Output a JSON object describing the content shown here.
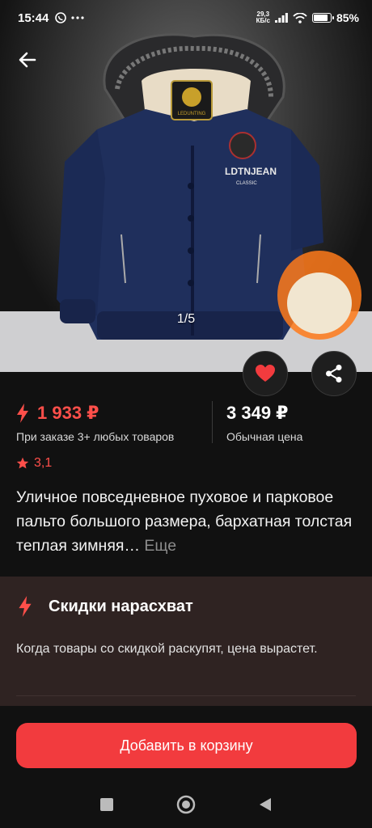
{
  "status_bar": {
    "time": "15:44",
    "net_speed_value": "29,3",
    "net_speed_unit": "КБ/с",
    "battery_percent": "85%",
    "battery_level": 0.85
  },
  "gallery": {
    "counter": "1/5",
    "jacket_brand": "LDTNJEAN",
    "jacket_brand_sub": "CLASSIC",
    "jacket_patch": "LEDUNTING"
  },
  "price": {
    "promo_price": "1 933 ₽",
    "promo_note": "При заказе 3+ любых товаров",
    "regular_price": "3 349 ₽",
    "regular_note": "Обычная цена"
  },
  "rating": {
    "value": "3,1"
  },
  "product": {
    "title": "Уличное повседневное пуховое и парковое пальто большого размера, бархатная толстая теплая зимняя…",
    "more_label": "Еще"
  },
  "deal": {
    "title": "Скидки нарасхват",
    "text": "Когда товары со скидкой раскупят, цена вырастет."
  },
  "cart": {
    "label": "Добавить в корзину"
  },
  "colors": {
    "accent_red": "#f23b3e",
    "price_red": "#ff4f4a",
    "card_bg": "#2f2322",
    "page_bg": "#111111"
  },
  "icons": {
    "back": "arrow-left-icon",
    "favorite": "heart-icon",
    "share": "share-icon",
    "lightning": "lightning-icon",
    "star": "star-icon"
  }
}
